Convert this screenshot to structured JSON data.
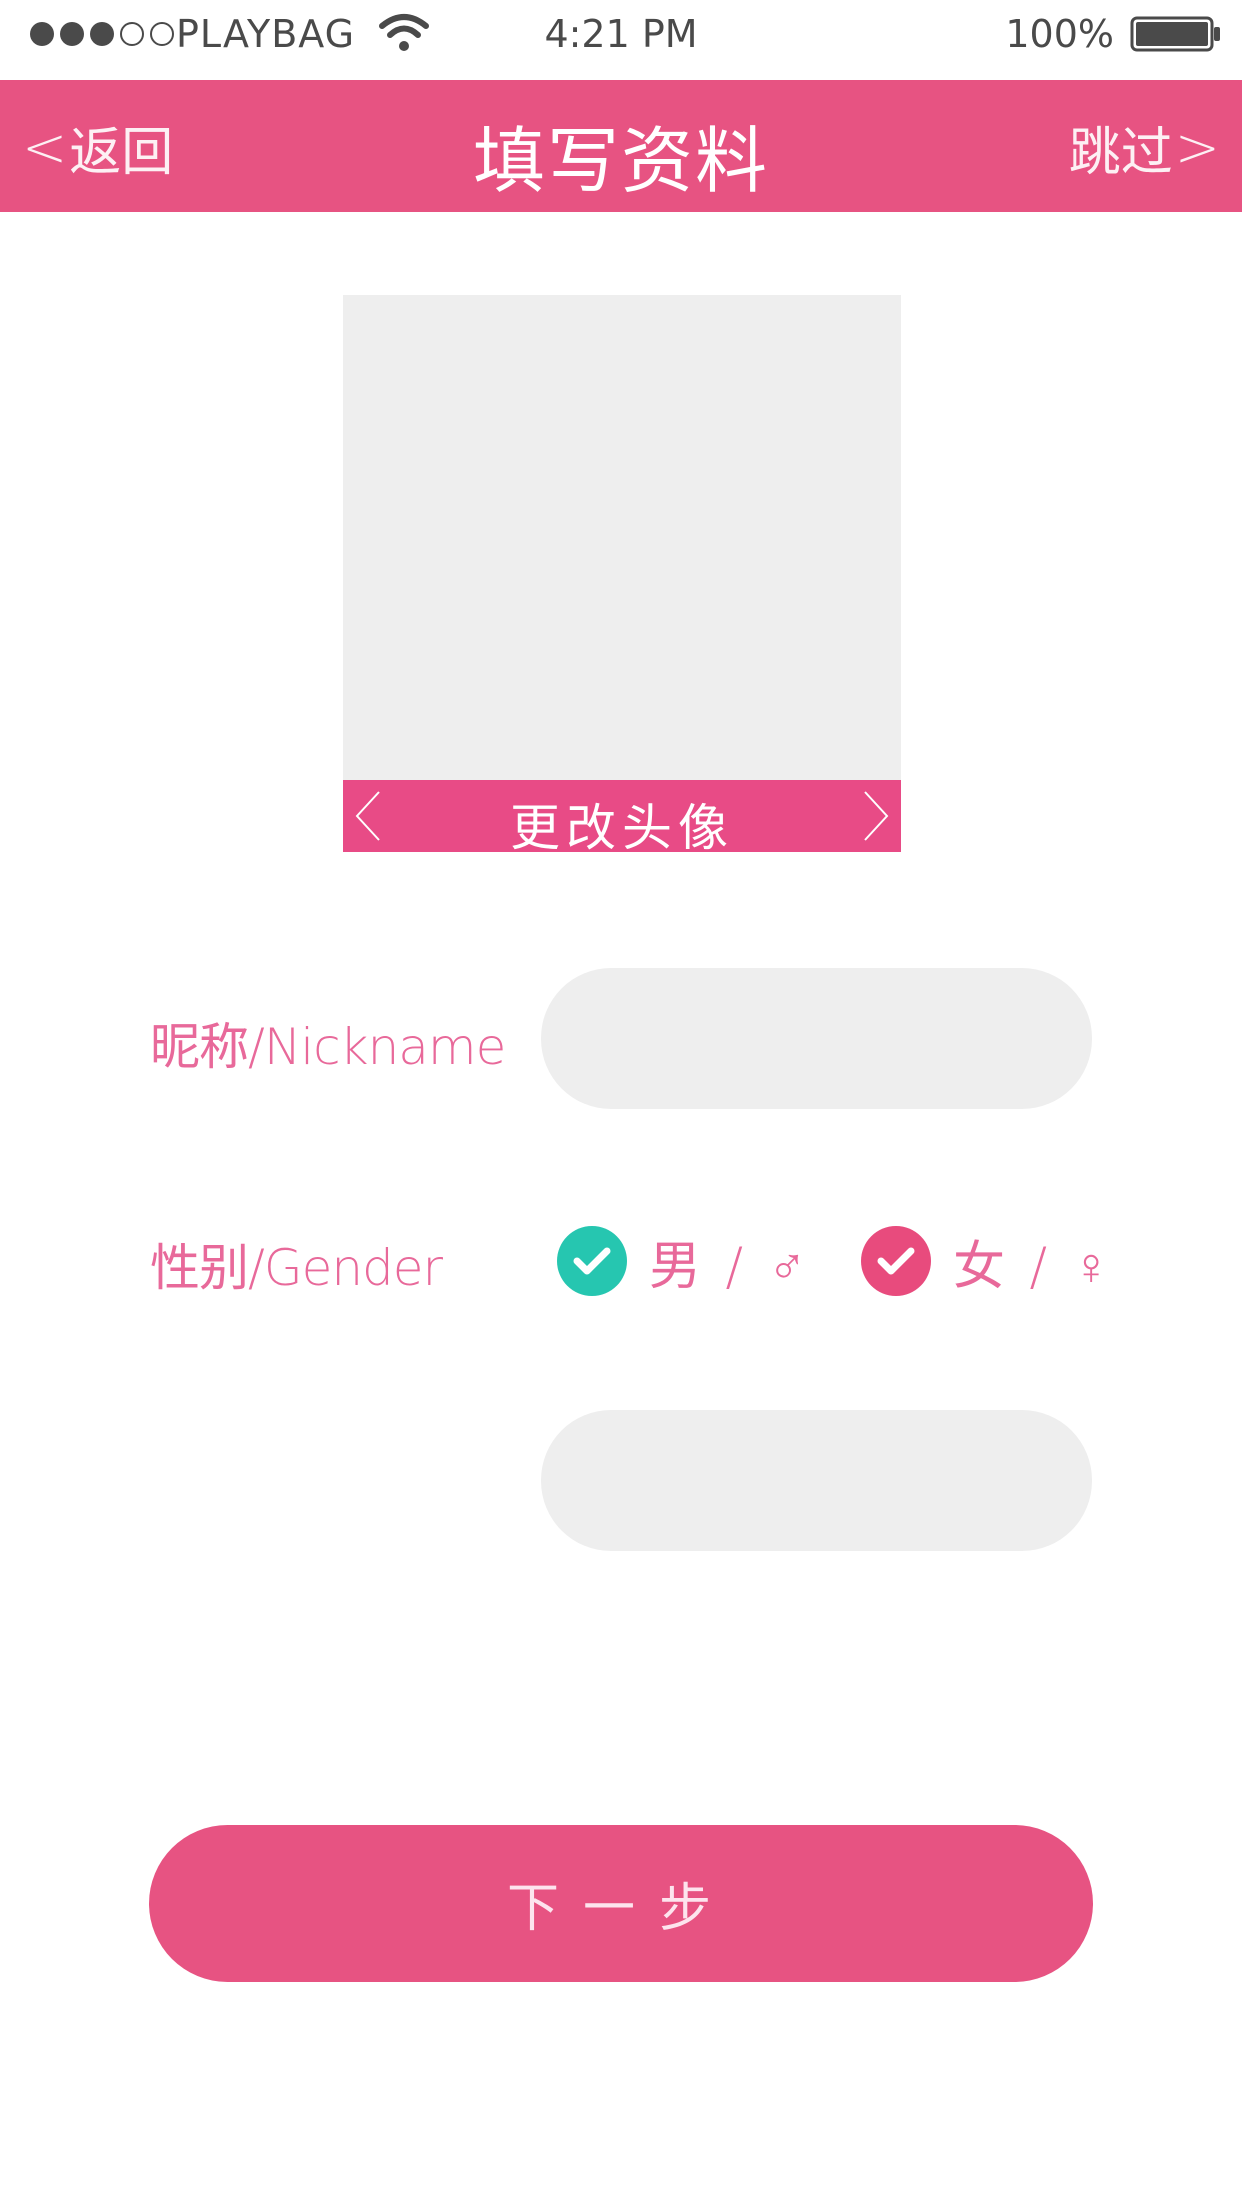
{
  "status_bar": {
    "carrier": "PLAYBAG",
    "time": "4:21 PM",
    "battery_percent": "100%",
    "signal_bars_filled": 3,
    "signal_bars_total": 5
  },
  "header": {
    "back_label": "返回",
    "back_chevron": "<",
    "title": "填写资料",
    "skip_label": "跳过",
    "skip_chevron": ">"
  },
  "avatar": {
    "change_label": "更改头像"
  },
  "form": {
    "nickname_label": "昵称/Nickname",
    "nickname_value": "",
    "gender_label": "性别/Gender",
    "gender_options": [
      {
        "label": "男 / ♂",
        "check_color": "#26c6b0"
      },
      {
        "label": "女 / ♀",
        "check_color": "#e84b7d"
      }
    ],
    "extra_value": ""
  },
  "next_button": {
    "label": "下一步"
  },
  "colors": {
    "brand": "#e75382",
    "label_text": "#e8699a",
    "input_bg": "#eeeeee",
    "male_accent": "#26c6b0",
    "female_accent": "#e84b7d"
  }
}
